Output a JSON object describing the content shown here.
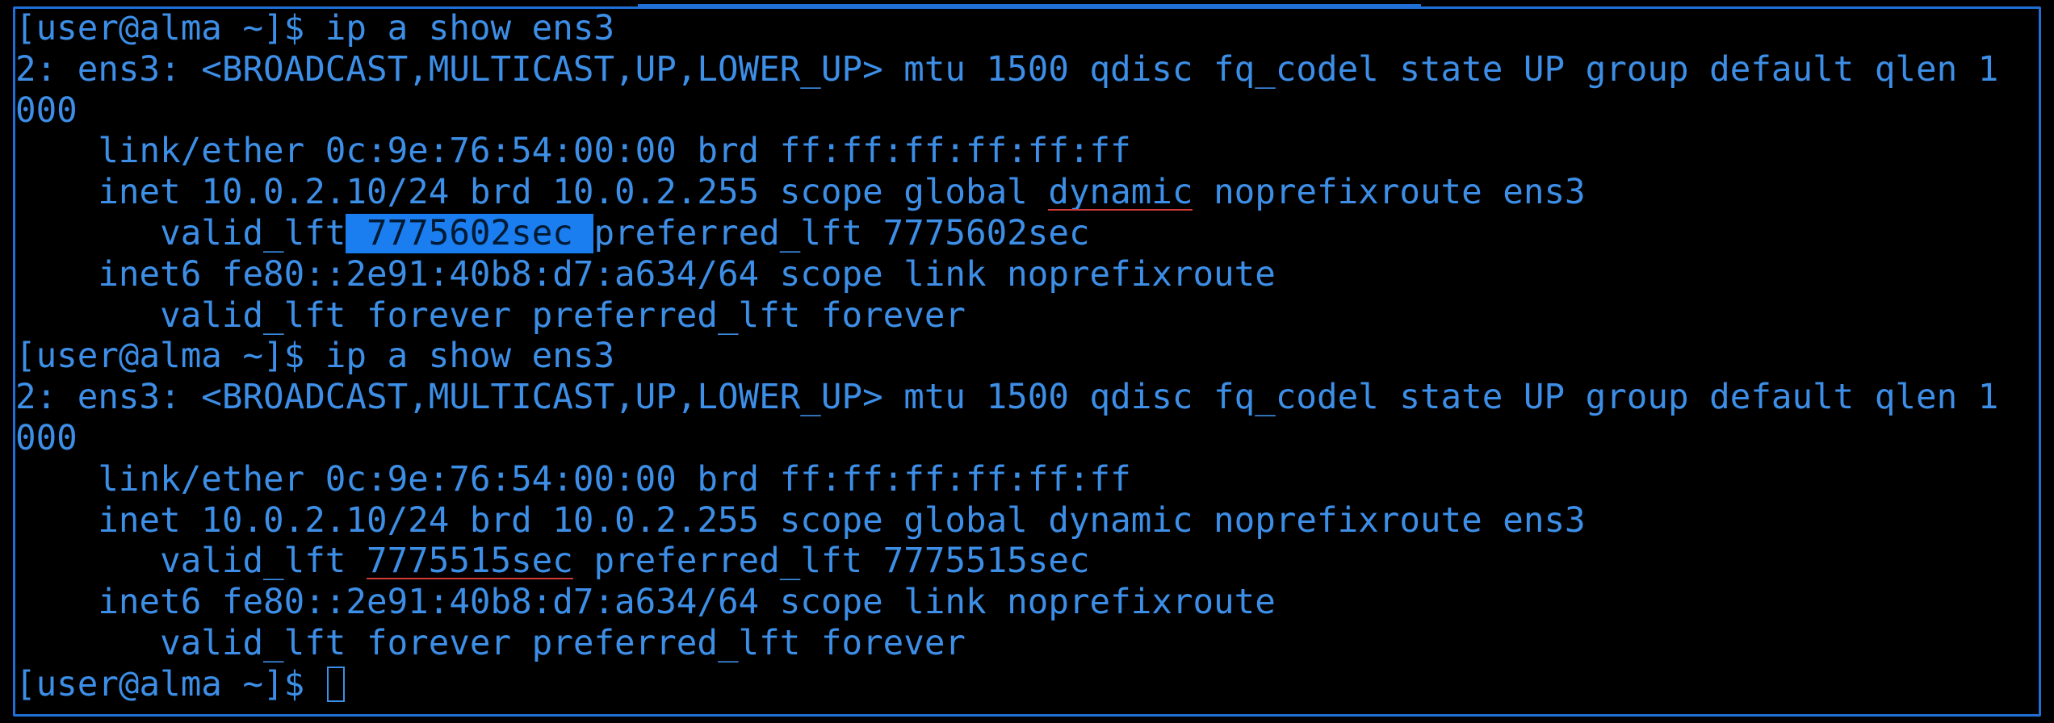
{
  "terminal": {
    "colors": {
      "text": "#3d8ee6",
      "background": "#000000",
      "border": "#1f6fd6",
      "selection": "#1b7ef0",
      "spellcheck": "#d23b3b"
    },
    "block1": {
      "prompt": "[user@alma ~]$ ip a show ens3",
      "l1": "2: ens3: <BROADCAST,MULTICAST,UP,LOWER_UP> mtu 1500 qdisc fq_codel state UP group default qlen 1",
      "l2": "000",
      "l3": "    link/ether 0c:9e:76:54:00:00 brd ff:ff:ff:ff:ff:ff",
      "l4_pre": "    inet 10.0.2.10/24 brd 10.0.2.255 scope global ",
      "l4_word": "dynamic",
      "l4_post": " noprefixroute ens3",
      "l5_pre": "       valid_lft",
      "l5_sel": " 7775602sec ",
      "l5_post": "preferred_lft 7775602sec",
      "l6": "    inet6 fe80::2e91:40b8:d7:a634/64 scope link noprefixroute",
      "l7": "       valid_lft forever preferred_lft forever"
    },
    "block2": {
      "prompt": "[user@alma ~]$ ip a show ens3",
      "l1": "2: ens3: <BROADCAST,MULTICAST,UP,LOWER_UP> mtu 1500 qdisc fq_codel state UP group default qlen 1",
      "l2": "000",
      "l3": "    link/ether 0c:9e:76:54:00:00 brd ff:ff:ff:ff:ff:ff",
      "l4": "    inet 10.0.2.10/24 brd 10.0.2.255 scope global dynamic noprefixroute ens3",
      "l5_pre": "       valid_lft ",
      "l5_word": "7775515sec",
      "l5_post": " preferred_lft 7775515sec",
      "l6": "    inet6 fe80::2e91:40b8:d7:a634/64 scope link noprefixroute",
      "l7": "       valid_lft forever preferred_lft forever"
    },
    "final_prompt": "[user@alma ~]$ "
  }
}
